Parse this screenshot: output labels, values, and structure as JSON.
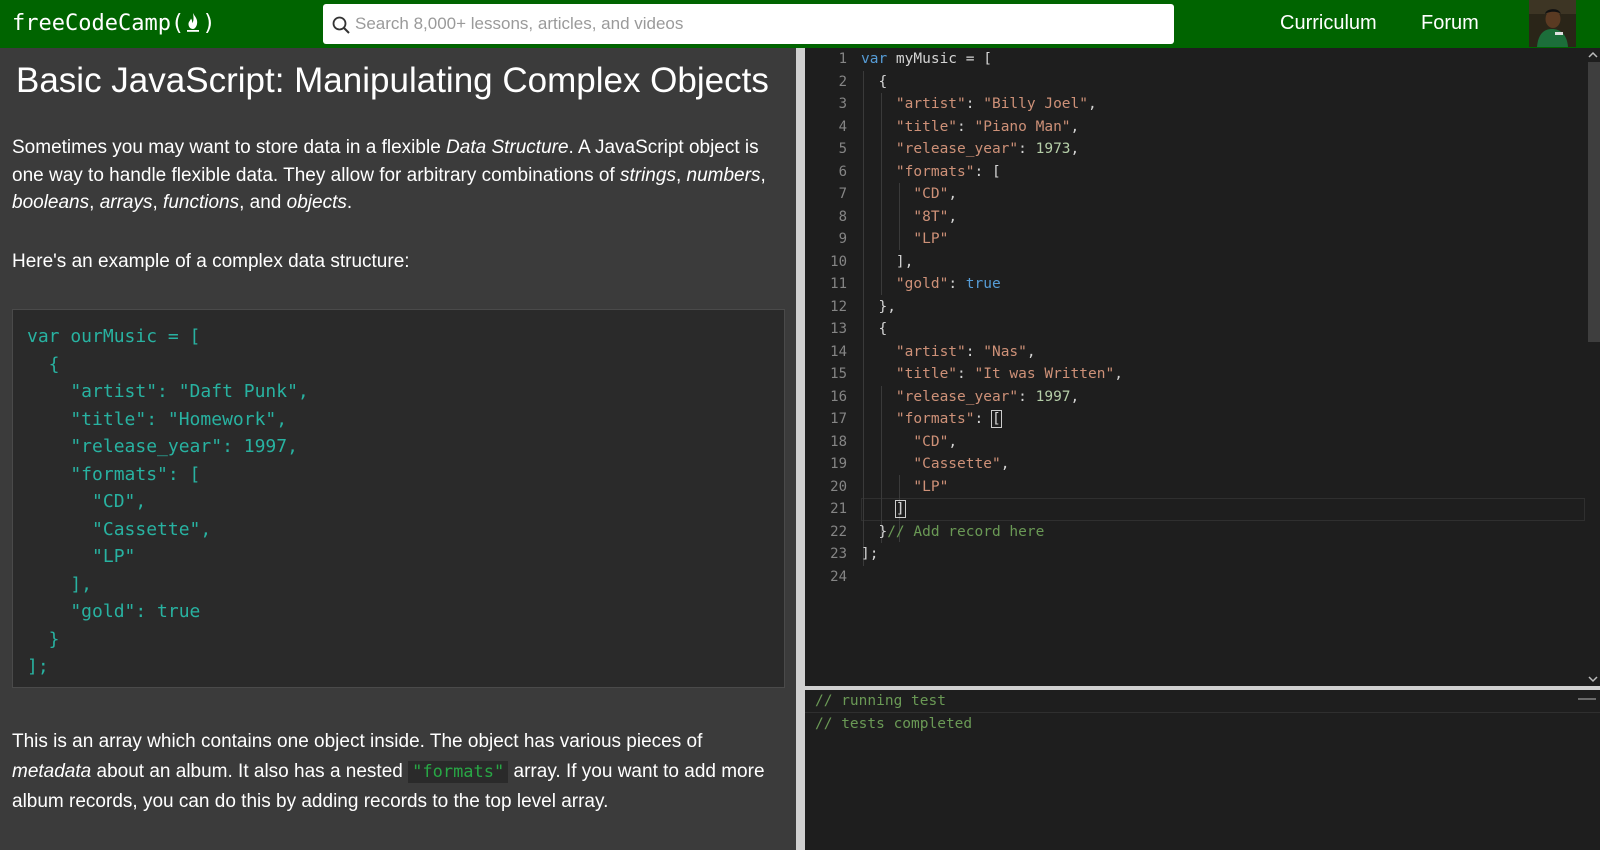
{
  "navbar": {
    "logo_text": "freeCodeCamp(",
    "logo_text_end": ")",
    "search_placeholder": "Search 8,000+ lessons, articles, and videos",
    "links": [
      "Curriculum",
      "Forum"
    ],
    "accent_color": "#006400"
  },
  "challenge": {
    "title": "Basic JavaScript: Manipulating Complex Objects",
    "p1": {
      "t1": "Sometimes you may want to store data in a flexible ",
      "e1": "Data Structure",
      "t2": ". A JavaScript object is one way to handle flexible data. They allow for arbitrary combinations of ",
      "e2": "strings",
      "t3": ", ",
      "e3": "numbers",
      "t4": ", ",
      "e4": "booleans",
      "t5": ", ",
      "e5": "arrays",
      "t6": ", ",
      "e6": "functions",
      "t7": ", and ",
      "e7": "objects",
      "t8": "."
    },
    "p2": "Here's an example of a complex data structure:",
    "example_code": [
      "var ourMusic = [",
      "  {",
      "    \"artist\": \"Daft Punk\",",
      "    \"title\": \"Homework\",",
      "    \"release_year\": 1997,",
      "    \"formats\": [",
      "      \"CD\",",
      "      \"Cassette\",",
      "      \"LP\"",
      "    ],",
      "    \"gold\": true",
      "  }",
      "];"
    ],
    "p3": {
      "t1": "This is an array which contains one object inside. The object has various pieces of ",
      "e1": "metadata",
      "t2": " about an album. It also has a nested ",
      "code": "\"formats\"",
      "t3": " array. If you want to add more album records, you can do this by adding records to the top level array."
    }
  },
  "editor": {
    "line_numbers": [
      "1",
      "2",
      "3",
      "4",
      "5",
      "6",
      "7",
      "8",
      "9",
      "10",
      "11",
      "12",
      "13",
      "14",
      "15",
      "16",
      "17",
      "18",
      "19",
      "20",
      "21",
      "22",
      "23",
      "24"
    ],
    "tokens": {
      "l1_kw": "var",
      "l1_rest": " myMusic = [",
      "l2": "  {",
      "l3_key": "\"artist\"",
      "l3_val": "\"Billy Joel\"",
      "l4_key": "\"title\"",
      "l4_val": "\"Piano Man\"",
      "l5_key": "\"release_year\"",
      "l5_val": "1973",
      "l6_key": "\"formats\"",
      "l7": "\"CD\"",
      "l8": "\"8T\"",
      "l9": "\"LP\"",
      "l10": "    ],",
      "l11_key": "\"gold\"",
      "l11_val": "true",
      "l12": "  },",
      "l13": "  {",
      "l14_key": "\"artist\"",
      "l14_val": "\"Nas\"",
      "l15_key": "\"title\"",
      "l15_val": "\"It was Written\"",
      "l16_key": "\"release_year\"",
      "l16_val": "1997",
      "l17_key": "\"formats\"",
      "l18": "\"CD\"",
      "l19": "\"Cassette\"",
      "l20": "\"LP\"",
      "l21": "]",
      "l22_brace": "}",
      "l22_comment": "// Add record here",
      "l23": "];"
    }
  },
  "output": {
    "lines": [
      "// running test",
      "// tests completed"
    ]
  }
}
